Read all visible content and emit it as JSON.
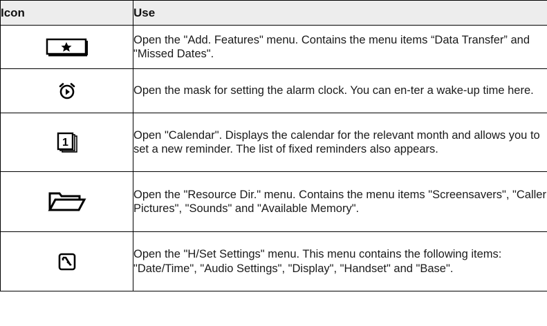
{
  "table": {
    "headers": {
      "icon": "Icon",
      "use": "Use"
    },
    "rows": [
      {
        "icon": "star-box-icon",
        "use": "Open the \"Add. Features\" menu. Contains the menu items “Data Transfer” and \"Missed Dates\"."
      },
      {
        "icon": "alarm-clock-icon",
        "use": "Open the mask for setting the alarm clock. You can en-ter a wake-up time here."
      },
      {
        "icon": "calendar-icon",
        "use": "Open \"Calendar\". Displays the calendar for the relevant month and allows you to set a new reminder. The list of fixed reminders also appears."
      },
      {
        "icon": "folder-icon",
        "use": "Open the \"Resource Dir.\" menu. Contains the menu items \"Screensavers\", \"Caller Pictures\", \"Sounds\" and \"Available Memory\"."
      },
      {
        "icon": "settings-icon",
        "use": "Open the \"H/Set Settings\" menu. This menu contains the following items: \"Date/Time\", \"Audio Settings\", \"Display\", \"Handset\" and \"Base\"."
      }
    ]
  }
}
